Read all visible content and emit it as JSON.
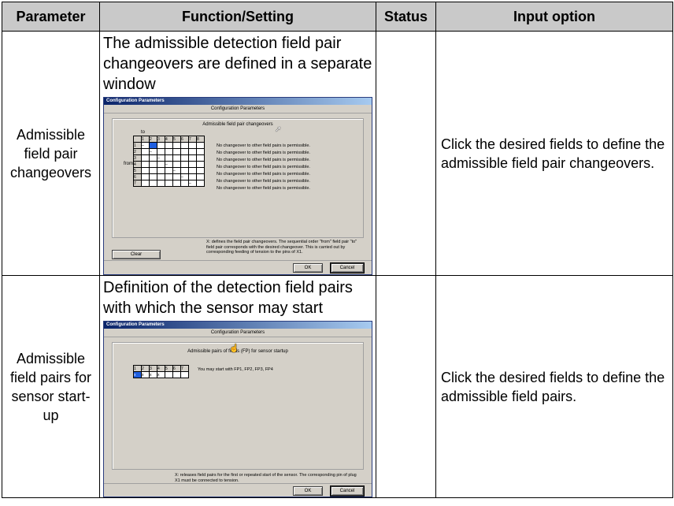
{
  "headers": {
    "parameter": "Parameter",
    "function": "Function/Setting",
    "status": "Status",
    "input": "Input option"
  },
  "rows": [
    {
      "parameter": "Admissible field pair changeovers",
      "function": "The admissible detection field pair changeovers are defined in a separate window",
      "status": "",
      "input": "Click the desired fields to define the admissible field pair changeovers.",
      "dialog": {
        "window_title": "Configuration Parameters",
        "caption": "Configuration Parameters",
        "group_title": "Admissible field pair changeovers",
        "to_label": "to",
        "from_label": "from",
        "col_numbers": [
          "1",
          "2",
          "3",
          "4",
          "5",
          "6",
          "7",
          "8"
        ],
        "row_numbers": [
          "1",
          "2",
          "3",
          "4",
          "5",
          "6",
          "7"
        ],
        "diag_mark": "–",
        "messages": [
          "No changeover to other field pairs is permissible.",
          "No changeover to other field pairs is permissible.",
          "No changeover to other field pairs is permissible.",
          "No changeover to other field pairs is permissible.",
          "No changeover to other field pairs is permissible.",
          "No changeover to other field pairs is permissible.",
          "No changeover to other field pairs is permissible."
        ],
        "note": "X: defines the field pair changeovers. The sequential order \"from\" field pair \"to\" field pair corresponds with the desired changeover. This is carried out by corresponding feeding of tension to the pins of X1.",
        "clear_button": "Clear",
        "ok_button": "OK",
        "cancel_button": "Cancel"
      }
    },
    {
      "parameter": "Admissible field pairs for sensor start-up",
      "function": "Definition of the detection field pairs with which the sensor may start",
      "status": "",
      "input": "Click the desired fields to define the admissible field pairs.",
      "dialog": {
        "window_title": "Configuration Parameters",
        "caption": "Configuration Parameters",
        "group_title": "Admissible pairs of fields (FP) for sensor startup",
        "col_numbers": [
          "1",
          "2",
          "3",
          "4",
          "5",
          "6",
          "7"
        ],
        "cells": [
          "x",
          "x",
          "x",
          "x",
          "",
          "",
          ""
        ],
        "start_message": "You may start with FP1, FP2, FP3, FP4",
        "note": "X: releases field pairs for the first or repeated start of the sensor. The corresponding pin of plug X1 must be connected to tension.",
        "ok_button": "OK",
        "cancel_button": "Cancel"
      }
    }
  ]
}
